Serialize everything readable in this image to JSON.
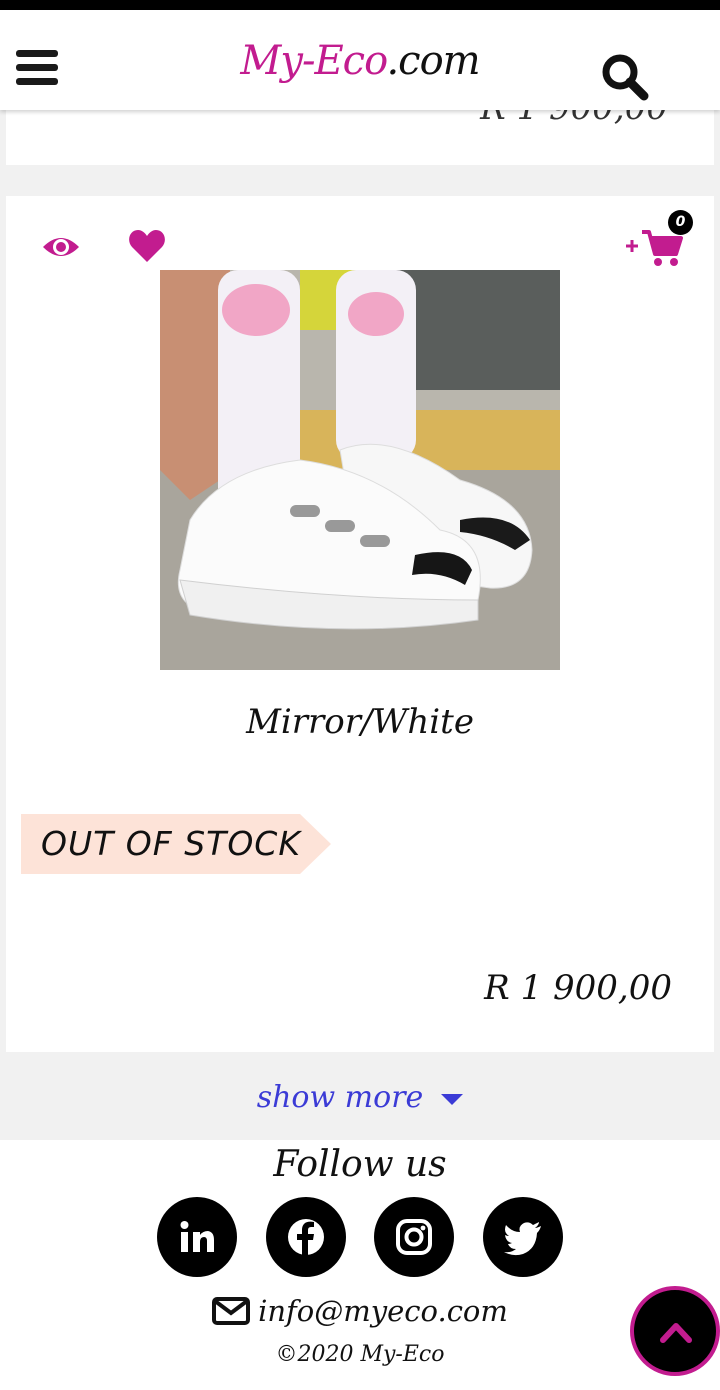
{
  "header": {
    "logo_brand": "My-Eco",
    "logo_domain": ".com"
  },
  "icons": {
    "menu": "hamburger-icon",
    "search": "search-icon",
    "quick_view": "eye-icon",
    "wishlist": "heart-icon",
    "cart": "cart-plus-icon",
    "email": "envelope-icon",
    "scroll_top": "chevron-up-icon"
  },
  "prev_product": {
    "price": "R 1 900,00"
  },
  "product": {
    "name": "Mirror/White",
    "stock_label": "OUT OF STOCK",
    "price": "R 1 900,00",
    "cart_count": "0"
  },
  "show_more": "show more",
  "footer": {
    "follow_title": "Follow us",
    "social": [
      "linkedin",
      "facebook",
      "instagram",
      "twitter"
    ],
    "email": "info@myeco.com",
    "copyright": "©2020 My-Eco"
  },
  "colors": {
    "accent": "#c21c8f",
    "link": "#3b3bd6",
    "badge_bg": "#fde3d8"
  }
}
